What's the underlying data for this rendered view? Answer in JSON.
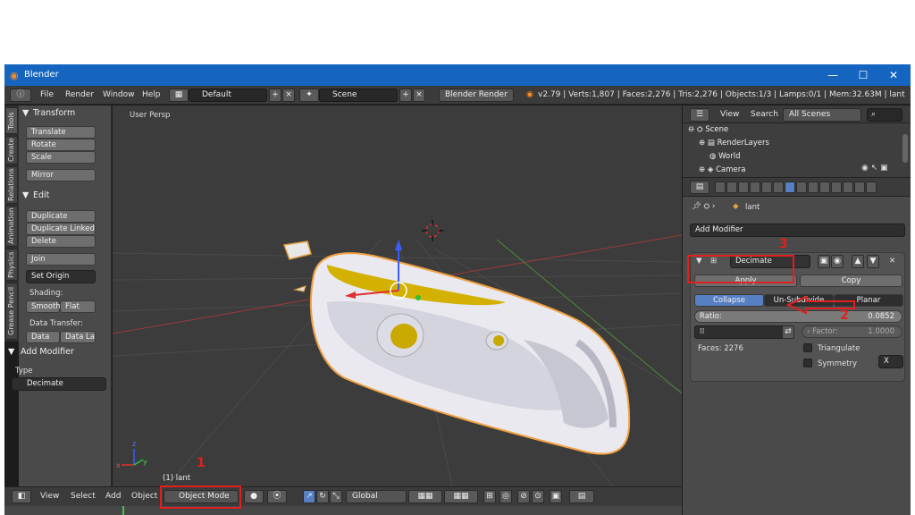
{
  "window": {
    "title": "Blender",
    "minimize": "—",
    "maximize": "☐",
    "close": "✕"
  },
  "infobar": {
    "menus": [
      "File",
      "Render",
      "Window",
      "Help"
    ],
    "layout": "Default",
    "scene": "Scene",
    "engine": "Blender Render",
    "stats": "v2.79 | Verts:1,807 | Faces:2,276 | Tris:2,276 | Objects:1/3 | Lamps:0/1 | Mem:32.63M | lant"
  },
  "tabs": [
    "Tools",
    "Create",
    "Relations",
    "Animation",
    "Physics",
    "Grease Pencil"
  ],
  "toolshelf": {
    "transform_header": "Transform",
    "translate": "Translate",
    "rotate": "Rotate",
    "scale": "Scale",
    "mirror": "Mirror",
    "edit_header": "Edit",
    "duplicate": "Duplicate",
    "duplicate_linked": "Duplicate Linked",
    "delete": "Delete",
    "join": "Join",
    "set_origin": "Set Origin",
    "shading_label": "Shading:",
    "smooth": "Smooth",
    "flat": "Flat",
    "data_transfer_label": "Data Transfer:",
    "data": "Data",
    "data_layout": "Data La",
    "add_modifier_header": "Add Modifier",
    "type_label": "Type",
    "type_value": "Decimate"
  },
  "viewport": {
    "view_name": "User Persp",
    "object_label": "(1) lant",
    "axis_x": "x",
    "axis_y": "y",
    "axis_z": "z"
  },
  "bottombar": {
    "menus": [
      "View",
      "Select",
      "Add",
      "Object"
    ],
    "mode": "Object Mode",
    "orientation": "Global"
  },
  "outliner": {
    "view": "View",
    "search": "Search",
    "filter": "All Scenes",
    "rows": [
      "Scene",
      "RenderLayers",
      "World",
      "Camera"
    ]
  },
  "properties": {
    "breadcrumb_object": "lant",
    "add_modifier": "Add Modifier",
    "modifier_name": "Decimate",
    "apply": "Apply",
    "copy": "Copy",
    "tabs": [
      "Collapse",
      "Un-Subdivide",
      "Planar"
    ],
    "ratio_label": "Ratio:",
    "ratio_value": "0.0852",
    "factor_label": "Factor:",
    "factor_value": "1.0000",
    "faces": "Faces: 2276",
    "triangulate": "Triangulate",
    "symmetry": "Symmetry",
    "symmetry_axis": "X"
  },
  "annotations": {
    "step1": "1",
    "step2": "2",
    "step3": "3",
    "color": "#e0201f"
  },
  "colors": {
    "accent_blue": "#5680c2",
    "title_bar": "#1565c0",
    "object_yellow": "#d4b000"
  }
}
